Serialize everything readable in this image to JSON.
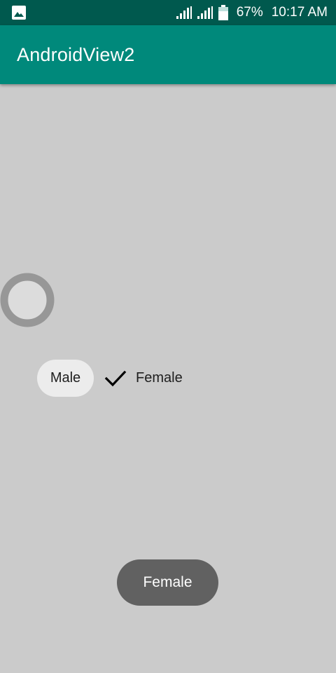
{
  "status_bar": {
    "battery_percent": "67%",
    "time": "10:17 AM",
    "icons": [
      "image-icon",
      "signal-icon",
      "signal-icon",
      "battery-icon"
    ]
  },
  "app_bar": {
    "title": "AndroidView2"
  },
  "chips": {
    "male_label": "Male",
    "female_label": "Female",
    "female_selected": true
  },
  "toast": {
    "text": "Female"
  },
  "colors": {
    "status_bar": "#00594e",
    "app_bar": "#00897b",
    "background": "#cbcbcb",
    "chip_male_bg": "#ececec",
    "toast_bg": "#616161"
  }
}
